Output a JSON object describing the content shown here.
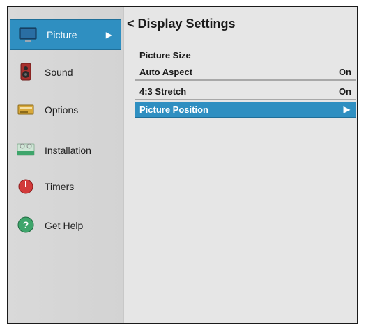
{
  "sidebar": {
    "items": [
      {
        "label": "Picture",
        "icon": "tv-monitor-icon",
        "active": true,
        "arrow": "▶"
      },
      {
        "label": "Sound",
        "icon": "speaker-icon"
      },
      {
        "label": "Options",
        "icon": "options-panel-icon"
      },
      {
        "label": "Installation",
        "icon": "installation-icon"
      },
      {
        "label": "Timers",
        "icon": "timer-icon"
      },
      {
        "label": "Get Help",
        "icon": "help-icon"
      }
    ]
  },
  "main": {
    "title": "< Display Settings",
    "rows": [
      {
        "label": "Picture Size",
        "value": ""
      },
      {
        "label": "Auto Aspect",
        "value": "On"
      },
      {
        "label": "4:3 Stretch",
        "value": "On"
      },
      {
        "label": "Picture Position",
        "value": "",
        "arrow": "▶",
        "selected": true
      }
    ]
  },
  "colors": {
    "accent": "#2f8fc1",
    "background": "#e6e6e6",
    "sidebar": "#d6d6d6"
  }
}
